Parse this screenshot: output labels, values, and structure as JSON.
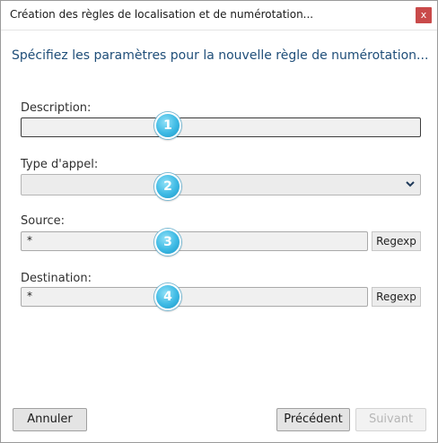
{
  "window": {
    "title": "Création des règles de localisation et de numérotation...",
    "close_glyph": "x"
  },
  "heading": "Spécifiez les paramètres pour la nouvelle règle de numérotation...",
  "fields": {
    "description": {
      "label": "Description:",
      "value": ""
    },
    "call_type": {
      "label": "Type d'appel:",
      "value": ""
    },
    "source": {
      "label": "Source:",
      "value": "*",
      "regexp_label": "Regexp"
    },
    "destination": {
      "label": "Destination:",
      "value": "*",
      "regexp_label": "Regexp"
    }
  },
  "badges": [
    "1",
    "2",
    "3",
    "4"
  ],
  "buttons": {
    "cancel": "Annuler",
    "previous": "Précédent",
    "next": "Suivant"
  },
  "colors": {
    "heading": "#1f4e79",
    "close": "#c94a4a",
    "badge": "#3cb9e4"
  }
}
